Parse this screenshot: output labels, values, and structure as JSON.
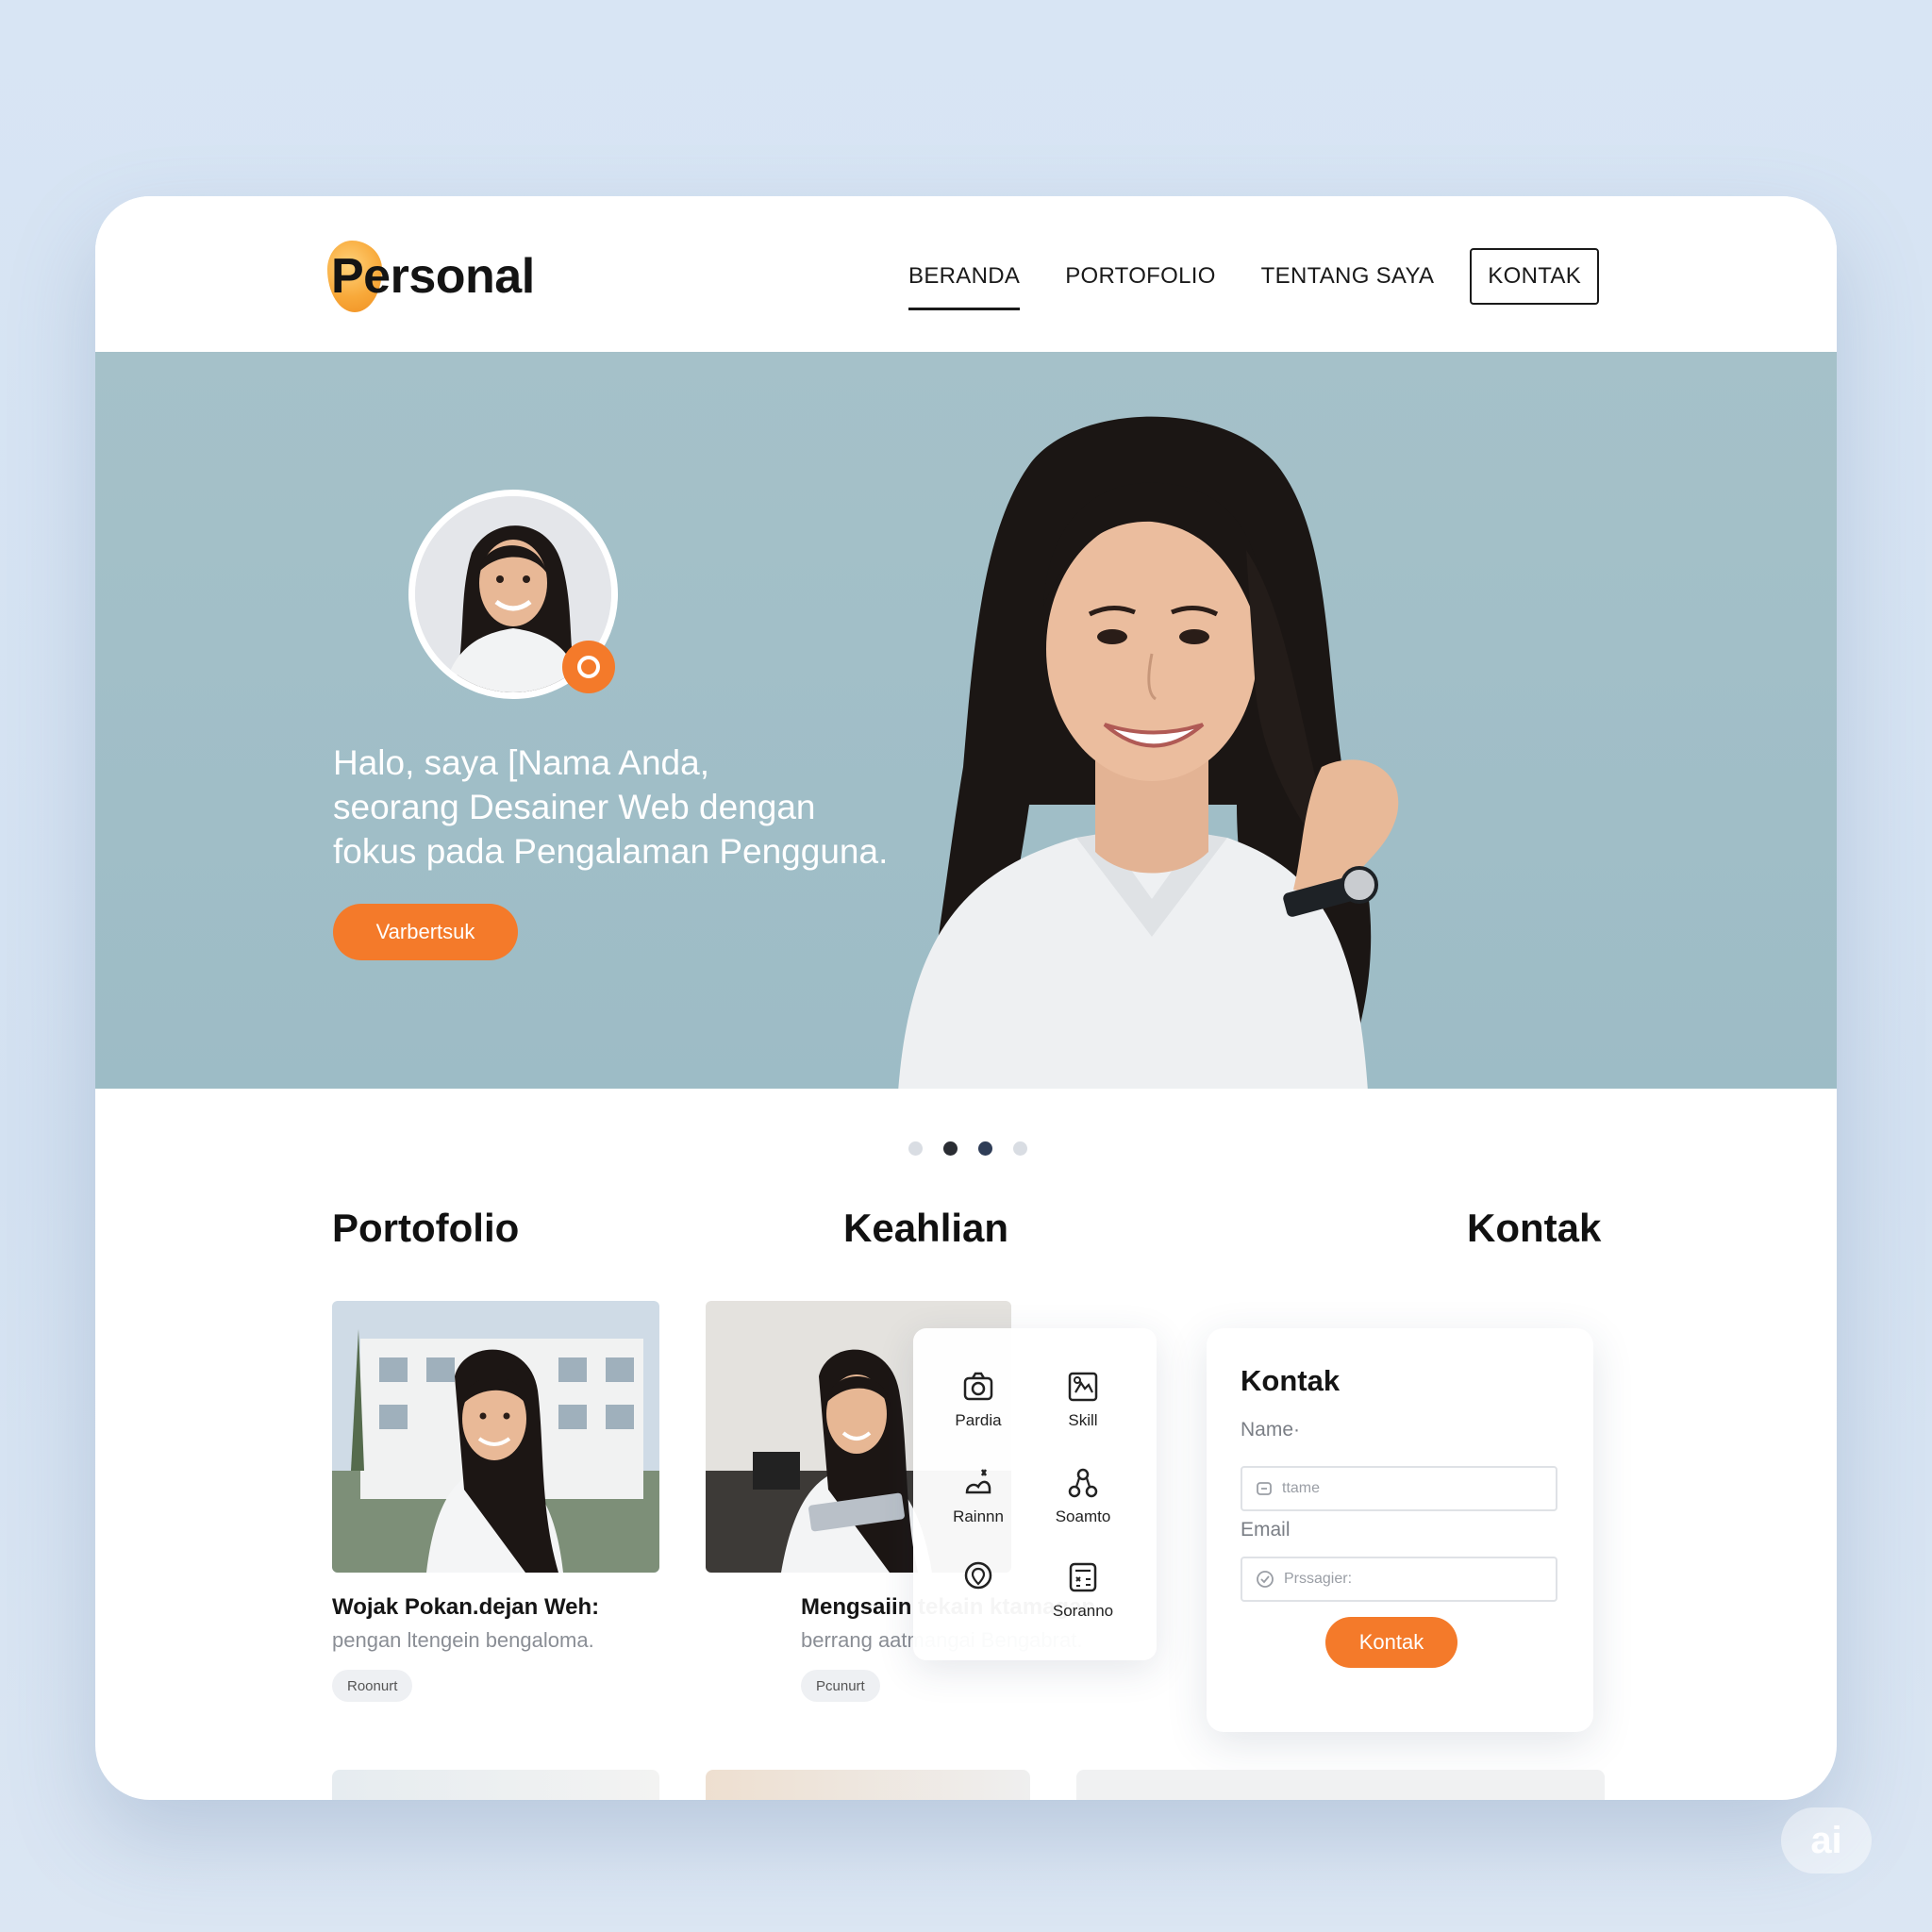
{
  "brand": {
    "logo_text": "Personal"
  },
  "nav": {
    "items": [
      {
        "label": "BERANDA",
        "active": true
      },
      {
        "label": "PORTOFOLIO",
        "active": false
      },
      {
        "label": "TENTANG SAYA",
        "active": false
      },
      {
        "label": "KONTAK",
        "active": false
      }
    ]
  },
  "hero": {
    "line1": "Halo, saya [Nama Anda,",
    "line2": "seorang Desainer Web dengan",
    "line3": "fokus pada Pengalaman Pengguna.",
    "cta": "Varbertsuk"
  },
  "carousel": {
    "total": 4,
    "active_index": 1
  },
  "sections": {
    "portfolio_title": "Portofolio",
    "skills_title": "Keahlian",
    "contact_title": "Kontak"
  },
  "portfolio": [
    {
      "title": "Wojak Pokan.dejan Weh:",
      "subtitle": "pengan ltengein bengaloma.",
      "chip": "Roonurt"
    },
    {
      "title": "Mengsaiin tekain ktamagan",
      "subtitle": "berrang aatmangai Bengabrat.",
      "chip": "Pcunurt"
    }
  ],
  "skills": [
    {
      "label": "Pardia",
      "icon": "camera-icon"
    },
    {
      "label": "Skill",
      "icon": "design-board-icon"
    },
    {
      "label": "Rainnn",
      "icon": "tools-icon"
    },
    {
      "label": "Soamto",
      "icon": "network-nodes-icon"
    },
    {
      "label": "",
      "icon": "location-pin-icon"
    },
    {
      "label": "Soranno",
      "icon": "calculator-icon"
    }
  ],
  "contact": {
    "title": "Kontak",
    "name_label": "Name·",
    "name_placeholder": "ttame",
    "email_label": "Email",
    "email_placeholder": "Prssagier:",
    "button": "Kontak"
  },
  "watermark": "ai",
  "colors": {
    "accent": "#f47a2a",
    "hero_bg": "#a1bec7",
    "page_bg": "#d6e3f2"
  }
}
